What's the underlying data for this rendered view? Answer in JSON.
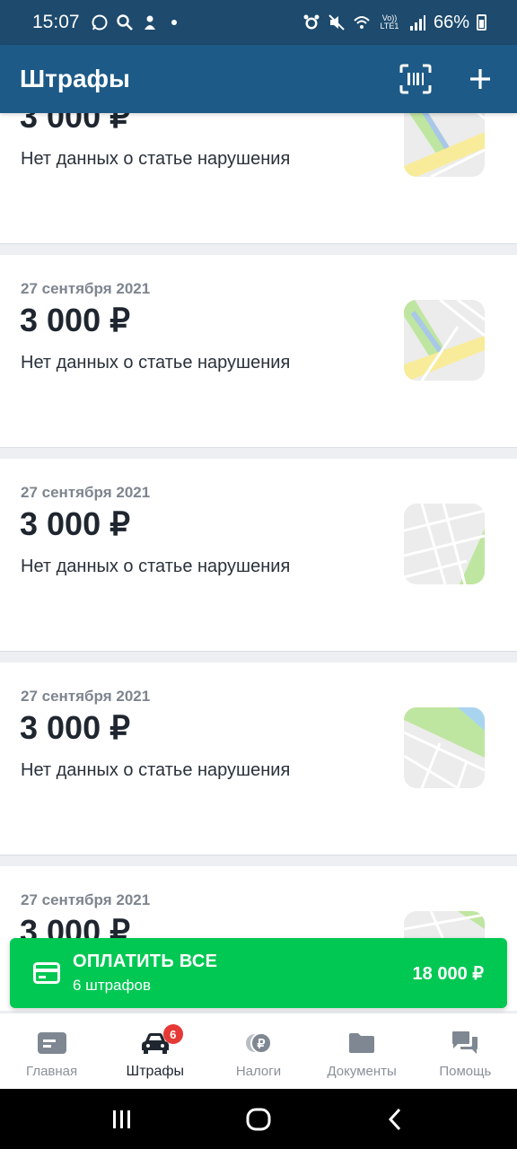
{
  "status_bar": {
    "time": "15:07",
    "network": "Vo)) LTE1",
    "battery": "66%"
  },
  "app_bar": {
    "title": "Штрафы"
  },
  "fines": [
    {
      "date": "",
      "amount": "3 000 ₽",
      "description": "Нет данных о статье нарушения",
      "map": "map-a"
    },
    {
      "date": "27 сентября 2021",
      "amount": "3 000 ₽",
      "description": "Нет данных о статье нарушения",
      "map": "map-b"
    },
    {
      "date": "27 сентября 2021",
      "amount": "3 000 ₽",
      "description": "Нет данных о статье нарушения",
      "map": "map-c"
    },
    {
      "date": "27 сентября 2021",
      "amount": "3 000 ₽",
      "description": "Нет данных о статье нарушения",
      "map": "map-d"
    },
    {
      "date": "27 сентября 2021",
      "amount": "3 000 ₽",
      "description": "",
      "map": "map-e"
    }
  ],
  "pay_all": {
    "title": "ОПЛАТИТЬ ВСЕ",
    "subtitle": "6 штрафов",
    "total": "18 000 ₽"
  },
  "bottom_nav": {
    "items": [
      {
        "label": "Главная",
        "icon": "home-card-icon"
      },
      {
        "label": "Штрафы",
        "icon": "car-icon",
        "badge": "6",
        "active": true
      },
      {
        "label": "Налоги",
        "icon": "ruble-coins-icon"
      },
      {
        "label": "Документы",
        "icon": "folder-icon"
      },
      {
        "label": "Помощь",
        "icon": "chat-bubbles-icon"
      }
    ]
  },
  "colors": {
    "status_bar": "#1d4a6d",
    "app_bar": "#1d5a87",
    "pay_button": "#00c853",
    "badge": "#e53935"
  }
}
